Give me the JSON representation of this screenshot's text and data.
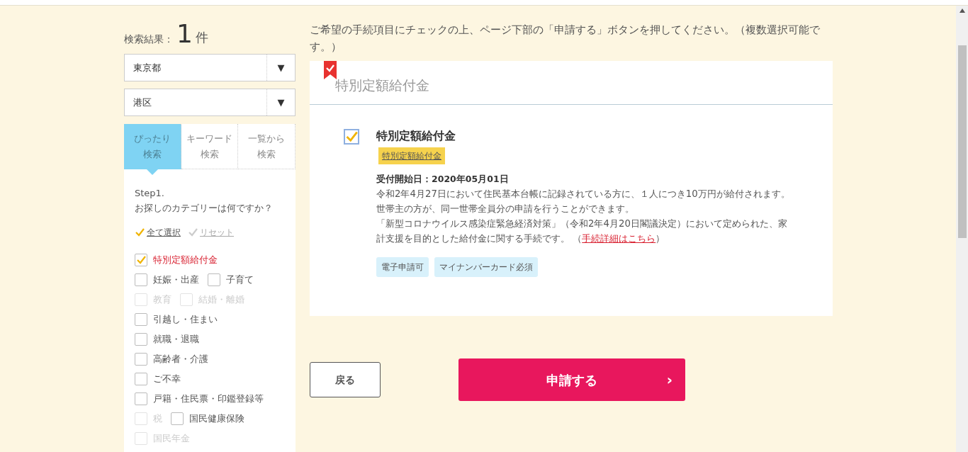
{
  "sidebar": {
    "result_label": "検索結果：",
    "result_count": "1",
    "result_unit": "件",
    "selects": [
      {
        "value": "東京都",
        "arrow": "▼"
      },
      {
        "value": "港区",
        "arrow": "▼"
      }
    ],
    "tabs": [
      {
        "lines": [
          "ぴったり",
          "検索"
        ],
        "selected": true
      },
      {
        "lines": [
          "キーワード",
          "検索"
        ],
        "selected": false
      },
      {
        "lines": [
          "一覧から",
          "検索"
        ],
        "selected": false
      }
    ],
    "step": "Step1.",
    "question": "お探しのカテゴリーは何ですか？",
    "actions": [
      {
        "label": "全て選択",
        "active": true
      },
      {
        "label": "リセット",
        "active": false
      }
    ],
    "category_rows": [
      [
        {
          "label": "特別定額給付金",
          "checked": true,
          "disabled": false
        }
      ],
      [
        {
          "label": "妊娠・出産",
          "checked": false,
          "disabled": false
        },
        {
          "label": "子育て",
          "checked": false,
          "disabled": false
        }
      ],
      [
        {
          "label": "教育",
          "checked": false,
          "disabled": true
        },
        {
          "label": "結婚・離婚",
          "checked": false,
          "disabled": true
        }
      ],
      [
        {
          "label": "引越し・住まい",
          "checked": false,
          "disabled": false
        }
      ],
      [
        {
          "label": "就職・退職",
          "checked": false,
          "disabled": false
        }
      ],
      [
        {
          "label": "高齢者・介護",
          "checked": false,
          "disabled": false
        }
      ],
      [
        {
          "label": "ご不幸",
          "checked": false,
          "disabled": false
        }
      ],
      [
        {
          "label": "戸籍・住民票・印鑑登録等",
          "checked": false,
          "disabled": false
        }
      ],
      [
        {
          "label": "税",
          "checked": false,
          "disabled": true
        },
        {
          "label": "国民健康保険",
          "checked": false,
          "disabled": false
        }
      ],
      [
        {
          "label": "国民年金",
          "checked": false,
          "disabled": true
        }
      ]
    ]
  },
  "main": {
    "instruction": "ご希望の手続項目にチェックの上、ページ下部の「申請する」ボタンを押してください。（複数選択可能です。）",
    "card": {
      "title": "特別定額給付金",
      "item": {
        "title": "特別定額給付金",
        "checked": true,
        "tag": "特別定額給付金",
        "start_date": "受付開始日：2020年05月01日",
        "paragraphs": [
          "令和2年4月27日において住民基本台帳に記録されている方に、１人につき10万円が給付されます。",
          "世帯主の方が、同一世帯全員分の申請を行うことができます。"
        ],
        "closing": {
          "text": "「新型コロナウイルス感染症緊急経済対策」（令和2年4月20日閣議決定）において定められた、家計支援を目的とした給付金に関する手続です。 （",
          "link": "手続詳細はこちら",
          "after": "）"
        },
        "badges": [
          "電子申請可",
          "マイナンバーカード必須"
        ]
      }
    },
    "buttons": [
      {
        "label": "戻る",
        "kind": "back"
      },
      {
        "label": "申請する",
        "kind": "submit",
        "arrow": "›"
      }
    ]
  }
}
